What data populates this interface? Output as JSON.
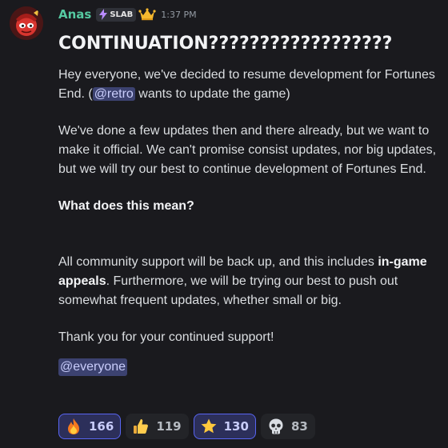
{
  "message": {
    "author": "Anas",
    "tag": {
      "label": "SLAB",
      "icon": "lightning-bolt-icon"
    },
    "badge_icon": "crown-icon",
    "timestamp": "1:37 PM",
    "headline": "CONTINUATION??????????????????",
    "paragraph1": {
      "before": "Hey everyone, we've decided to resume development for Fortunes End. (",
      "mention": "@retro",
      "after": " wants to update the game)"
    },
    "paragraph2": "We've done a few updates then and there already, but we want to make it official. We can't promise consist updates, nor big updates, but we will try our best to continue development of Fortunes End.",
    "paragraph3": "What does this mean?",
    "paragraph4": {
      "before": "All community support will be back up, and this includes ",
      "strong": "in-game appeals",
      "after": ". Furthermore, we will be trying our best to push out somewhat frequent updates, whether small or big."
    },
    "paragraph5": "Thank you for your continued support!",
    "everyone_mention": "@everyone"
  },
  "reactions": [
    {
      "emoji": "fire-emoji",
      "count": "166",
      "active": true
    },
    {
      "emoji": "thumbs-up-emoji",
      "count": "119",
      "active": false
    },
    {
      "emoji": "star-emoji",
      "count": "130",
      "active": true
    },
    {
      "emoji": "skull-emoji",
      "count": "83",
      "active": false
    }
  ],
  "colors": {
    "background": "#1a1a1e",
    "username": "#55c9a1",
    "mention_bg": "#3c4270",
    "mention_text": "#c9cdfb",
    "reaction_active_border": "#5865f2"
  }
}
